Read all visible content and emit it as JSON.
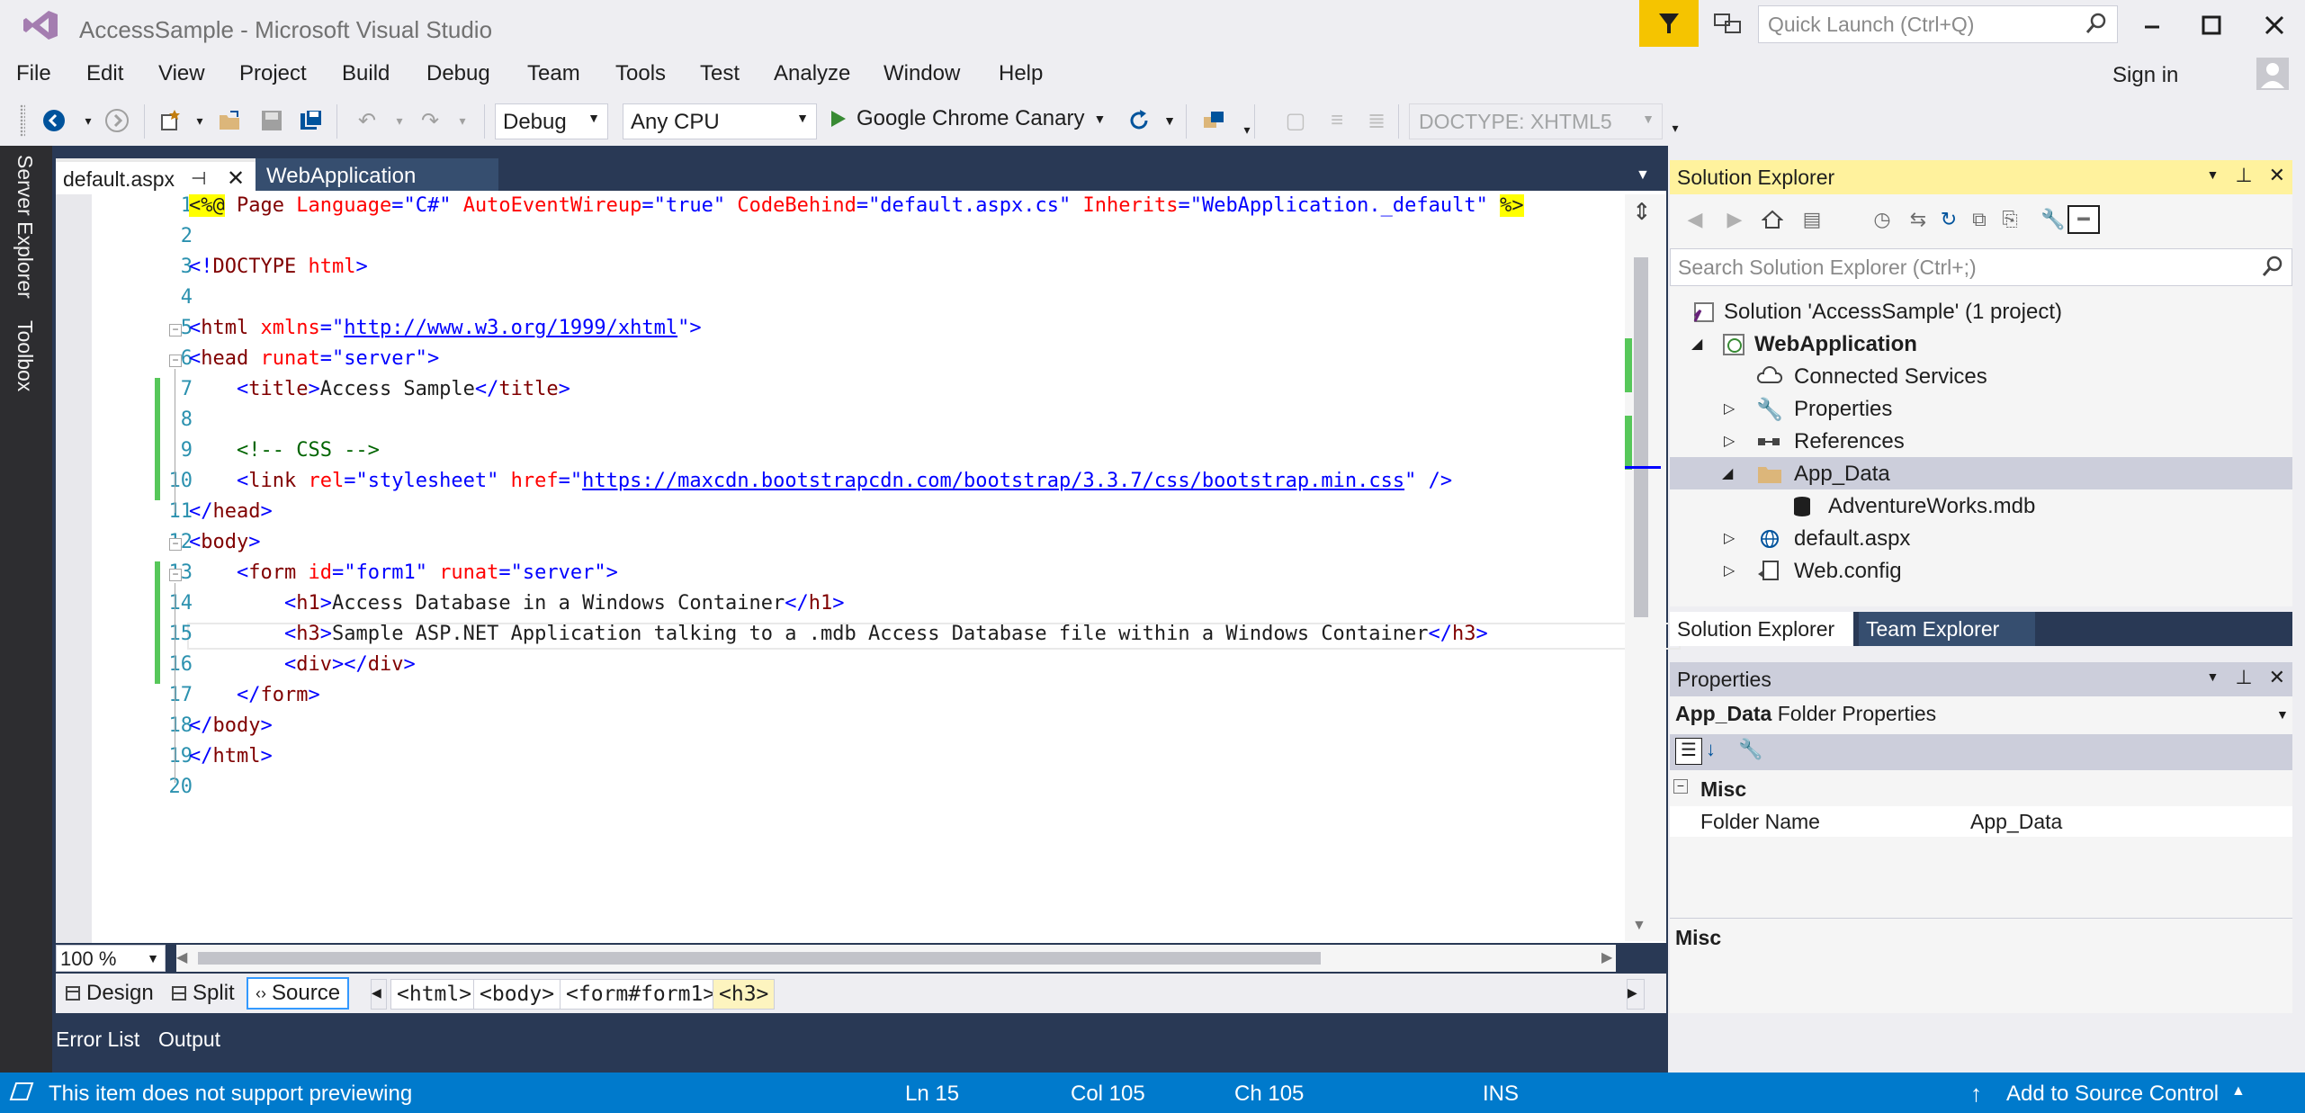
{
  "window": {
    "title": "AccessSample - Microsoft Visual Studio",
    "quick_launch_placeholder": "Quick Launch (Ctrl+Q)",
    "sign_in": "Sign in"
  },
  "menu": [
    "File",
    "Edit",
    "View",
    "Project",
    "Build",
    "Debug",
    "Team",
    "Tools",
    "Test",
    "Analyze",
    "Window",
    "Help"
  ],
  "toolbar": {
    "configuration": "Debug",
    "platform": "Any CPU",
    "run_target": "Google Chrome Canary",
    "doctype": "DOCTYPE: XHTML5"
  },
  "left_dock": {
    "server_explorer": "Server Explorer",
    "toolbox": "Toolbox"
  },
  "doc_tabs": {
    "active": "default.aspx",
    "inactive": "WebApplication"
  },
  "editor": {
    "line_numbers": [
      "1",
      "2",
      "3",
      "4",
      "5",
      "6",
      "7",
      "8",
      "9",
      "10",
      "11",
      "12",
      "13",
      "14",
      "15",
      "16",
      "17",
      "18",
      "19",
      "20"
    ],
    "zoom": "100 %"
  },
  "view_modes": {
    "design": "Design",
    "split": "Split",
    "source": "Source"
  },
  "breadcrumbs": [
    "<html>",
    "<body>",
    "<form#form1>",
    "<h3>"
  ],
  "bottom_tabs": {
    "error_list": "Error List",
    "output": "Output"
  },
  "status": {
    "message": "This item does not support previewing",
    "ln": "Ln 15",
    "col": "Col 105",
    "ch": "Ch 105",
    "mode": "INS",
    "source_control": "Add to Source Control"
  },
  "solution_explorer": {
    "title": "Solution Explorer",
    "search_placeholder": "Search Solution Explorer (Ctrl+;)",
    "solution": "Solution 'AccessSample' (1 project)",
    "project": "WebApplication",
    "items": {
      "connected_services": "Connected Services",
      "properties": "Properties",
      "references": "References",
      "app_data": "App_Data",
      "mdb": "AdventureWorks.mdb",
      "default_aspx": "default.aspx",
      "web_config": "Web.config"
    },
    "tab_solution": "Solution Explorer",
    "tab_team": "Team Explorer"
  },
  "properties": {
    "title": "Properties",
    "object_name": "App_Data",
    "object_type": "Folder Properties",
    "category": "Misc",
    "row_name": "Folder Name",
    "row_value": "App_Data",
    "description_title": "Misc"
  },
  "colors": {
    "accent": "#007acc",
    "dock_bg": "#293955",
    "tab_inactive": "#364e6f",
    "notification": "#f5c400",
    "se_header": "#fff29d",
    "change_bar": "#57c75a"
  }
}
